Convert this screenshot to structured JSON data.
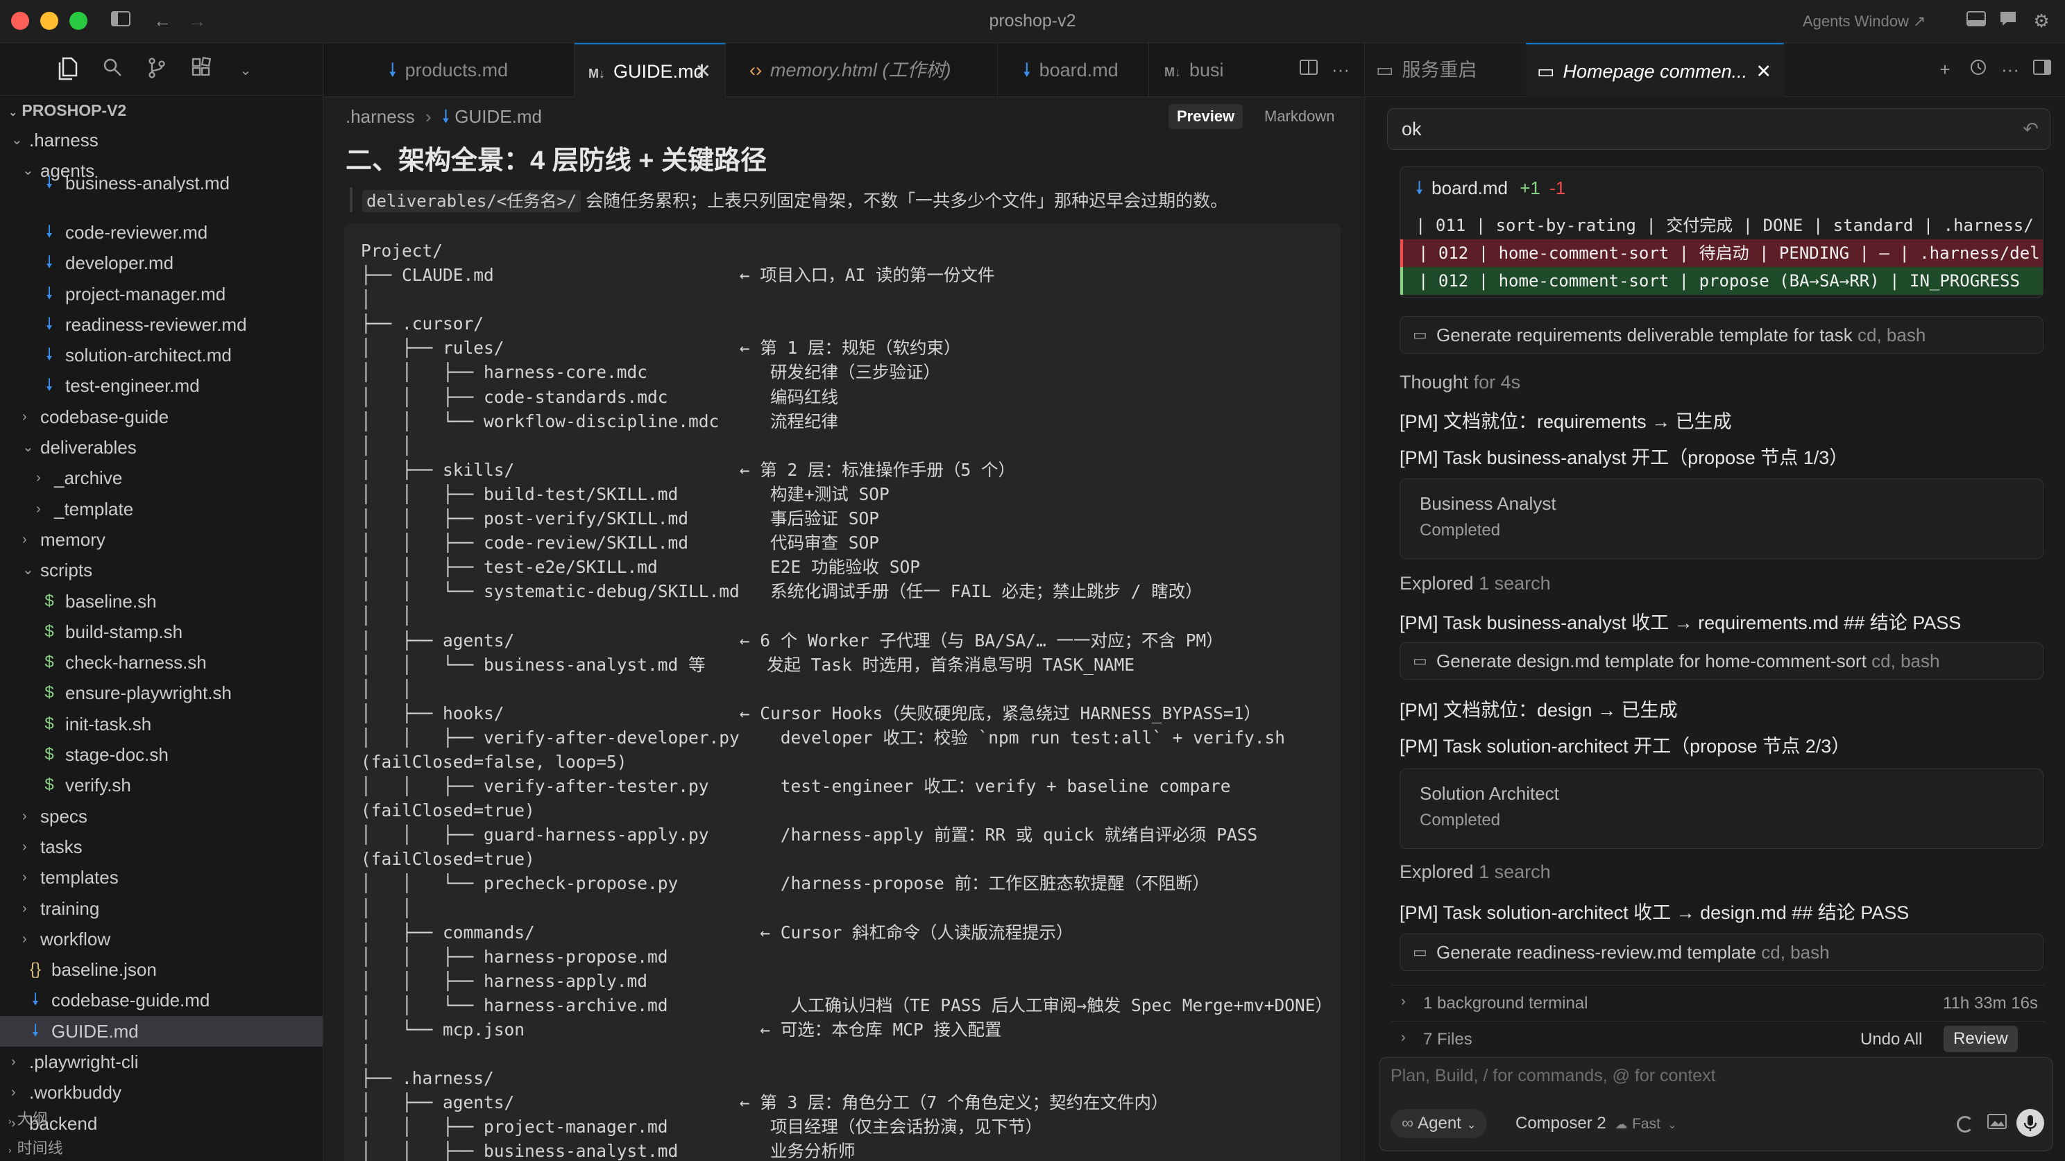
{
  "window": {
    "title": "proshop-v2",
    "agents_window_label": "Agents Window ↗"
  },
  "sidebar": {
    "project_title": "PROSHOP-V2",
    "rows": [
      {
        "label": ".harness",
        "kind": "folder",
        "open": true,
        "depth": 1
      },
      {
        "label": "agents",
        "kind": "folder",
        "open": true,
        "depth": 2
      },
      {
        "label": "business-analyst.md",
        "kind": "md",
        "depth": 3
      },
      {
        "label": "code-reviewer.md",
        "kind": "md",
        "depth": 3
      },
      {
        "label": "developer.md",
        "kind": "md",
        "depth": 3
      },
      {
        "label": "project-manager.md",
        "kind": "md",
        "depth": 3
      },
      {
        "label": "readiness-reviewer.md",
        "kind": "md",
        "depth": 3
      },
      {
        "label": "solution-architect.md",
        "kind": "md",
        "depth": 3
      },
      {
        "label": "test-engineer.md",
        "kind": "md",
        "depth": 3
      },
      {
        "label": "codebase-guide",
        "kind": "folder",
        "open": false,
        "depth": 2
      },
      {
        "label": "deliverables",
        "kind": "folder",
        "open": true,
        "depth": 2
      },
      {
        "label": "_archive",
        "kind": "folder",
        "open": false,
        "depth": 3
      },
      {
        "label": "_template",
        "kind": "folder",
        "open": false,
        "depth": 3
      },
      {
        "label": "memory",
        "kind": "folder",
        "open": false,
        "depth": 2
      },
      {
        "label": "scripts",
        "kind": "folder",
        "open": true,
        "depth": 2
      },
      {
        "label": "baseline.sh",
        "kind": "sh",
        "depth": 3
      },
      {
        "label": "build-stamp.sh",
        "kind": "sh",
        "depth": 3
      },
      {
        "label": "check-harness.sh",
        "kind": "sh",
        "depth": 3
      },
      {
        "label": "ensure-playwright.sh",
        "kind": "sh",
        "depth": 3
      },
      {
        "label": "init-task.sh",
        "kind": "sh",
        "depth": 3
      },
      {
        "label": "stage-doc.sh",
        "kind": "sh",
        "depth": 3
      },
      {
        "label": "verify.sh",
        "kind": "sh",
        "depth": 3
      },
      {
        "label": "specs",
        "kind": "folder",
        "open": false,
        "depth": 2
      },
      {
        "label": "tasks",
        "kind": "folder",
        "open": false,
        "depth": 2
      },
      {
        "label": "templates",
        "kind": "folder",
        "open": false,
        "depth": 2
      },
      {
        "label": "training",
        "kind": "folder",
        "open": false,
        "depth": 2
      },
      {
        "label": "workflow",
        "kind": "folder",
        "open": false,
        "depth": 2
      },
      {
        "label": "baseline.json",
        "kind": "json",
        "depth": 2
      },
      {
        "label": "codebase-guide.md",
        "kind": "md",
        "depth": 2
      },
      {
        "label": "GUIDE.md",
        "kind": "md",
        "depth": 2,
        "selected": true
      },
      {
        "label": ".playwright-cli",
        "kind": "folder",
        "open": false,
        "depth": 1
      },
      {
        "label": ".workbuddy",
        "kind": "folder",
        "open": false,
        "depth": 1
      },
      {
        "label": "backend",
        "kind": "folder",
        "open": false,
        "depth": 1
      }
    ],
    "outline_label": "大纲",
    "timeline_label": "时间线"
  },
  "editor_tabs": [
    {
      "label": "products.md",
      "icon": "md"
    },
    {
      "label": "GUIDE.md",
      "icon": "M↓",
      "active": true
    },
    {
      "label": "memory.html (工作树)",
      "icon": "html",
      "italic": true
    },
    {
      "label": "board.md",
      "icon": "md"
    },
    {
      "label": "busi",
      "icon": "M↓"
    }
  ],
  "editor": {
    "breadcrumb_folder": ".harness",
    "breadcrumb_file": "GUIDE.md",
    "preview_label": "Preview",
    "markdown_label": "Markdown",
    "heading": "二、架构全景：4 层防线 + 关键路径",
    "intro_code": "deliverables/<任务名>/",
    "intro_rest": " 会随任务累积；上表只列固定骨架，不数「一共多少个文件」那种迟早会过期的数。",
    "code_lines": [
      "Project/",
      "├── CLAUDE.md                        ← 项目入口，AI 读的第一份文件",
      "│",
      "├── .cursor/",
      "│   ├── rules/                       ← 第 1 层：规矩（软约束）",
      "│   │   ├── harness-core.mdc            研发纪律（三步验证）",
      "│   │   ├── code-standards.mdc          编码红线",
      "│   │   └── workflow-discipline.mdc     流程纪律",
      "│   │",
      "│   ├── skills/                      ← 第 2 层：标准操作手册（5 个）",
      "│   │   ├── build-test/SKILL.md         构建+测试 SOP",
      "│   │   ├── post-verify/SKILL.md        事后验证 SOP",
      "│   │   ├── code-review/SKILL.md        代码审查 SOP",
      "│   │   ├── test-e2e/SKILL.md           E2E 功能验收 SOP",
      "│   │   └── systematic-debug/SKILL.md   系统化调试手册（任一 FAIL 必走；禁止跳步 / 瞎改）",
      "│   │",
      "│   ├── agents/                      ← 6 个 Worker 子代理（与 BA/SA/… 一一对应；不含 PM）",
      "│   │   └── business-analyst.md 等      发起 Task 时选用，首条消息写明 TASK_NAME",
      "│   │",
      "│   ├── hooks/                       ← Cursor Hooks（失败硬兜底，紧急绕过 HARNESS_BYPASS=1）",
      "│   │   ├── verify-after-developer.py    developer 收工：校验 `npm run test:all` + verify.sh",
      "(failClosed=false, loop=5)",
      "│   │   ├── verify-after-tester.py       test-engineer 收工：verify + baseline compare",
      "(failClosed=true)",
      "│   │   ├── guard-harness-apply.py       /harness-apply 前置：RR 或 quick 就绪自评必须 PASS",
      "(failClosed=true)",
      "│   │   └── precheck-propose.py          /harness-propose 前：工作区脏态软提醒（不阻断）",
      "│   │",
      "│   ├── commands/                      ← Cursor 斜杠命令（人读版流程提示）",
      "│   │   ├── harness-propose.md",
      "│   │   ├── harness-apply.md",
      "│   │   └── harness-archive.md            人工确认归档（TE PASS 后人工审阅→触发 Spec Merge+mv+DONE）",
      "│   └── mcp.json                       ← 可选：本仓库 MCP 接入配置",
      "│",
      "├── .harness/",
      "│   ├── agents/                      ← 第 3 层：角色分工（7 个角色定义；契约在文件内）",
      "│   │   ├── project-manager.md          项目经理（仅主会话扮演，见下节）",
      "│   │   ├── business-analyst.md         业务分析师"
    ]
  },
  "agent_panel": {
    "tabs": [
      {
        "label": "服务重启"
      },
      {
        "label": "Homepage commen...",
        "active": true
      }
    ],
    "input_value": "ok",
    "diff_file": "board.md",
    "diff_add": "+1",
    "diff_del": "-1",
    "diff_lines": [
      {
        "type": "ctx",
        "text": "| 011 | sort-by-rating | 交付完成 | DONE | standard | .harness/"
      },
      {
        "type": "del",
        "text": "| 012 | home-comment-sort | 待启动 | PENDING | — | .harness/del"
      },
      {
        "type": "add",
        "text": "| 012 | home-comment-sort | propose (BA→SA→RR)  | IN_PROGRESS"
      }
    ],
    "tool1_label": "Generate requirements deliverable template for task",
    "tool1_suffix": "cd, bash",
    "thought_label": "Thought",
    "thought_time": "for 4s",
    "line_pm_req": "[PM] 文档就位：requirements → 已生成",
    "line_ba_start": "[PM] Task business-analyst 开工（propose 节点 1/3）",
    "card_ba_title": "Business Analyst",
    "card_ba_status": "Completed",
    "explored1_label": "Explored",
    "explored1_count": "1 search",
    "line_ba_done": "[PM] Task business-analyst 收工 → requirements.md ## 结论 PASS",
    "tool2_label": "Generate design.md template for home-comment-sort",
    "tool2_suffix": "cd, bash",
    "line_pm_design": "[PM] 文档就位：design → 已生成",
    "line_sa_start": "[PM] Task solution-architect 开工（propose 节点 2/3）",
    "card_sa_title": "Solution Architect",
    "card_sa_status": "Completed",
    "explored2_label": "Explored",
    "explored2_count": "1 search",
    "line_sa_done": "[PM] Task solution-architect 收工 → design.md ## 结论 PASS",
    "tool3_label": "Generate readiness-review.md template",
    "tool3_suffix": "cd, bash",
    "bg_terminal_label": "1 background terminal",
    "bg_terminal_time": "11h 33m 16s",
    "files_label": "7 Files",
    "undo_all_label": "Undo All",
    "review_label": "Review",
    "composer_placeholder": "Plan, Build, / for commands, @ for context",
    "agent_mode_label": "Agent",
    "model_label": "Composer 2",
    "speed_label": "Fast"
  }
}
